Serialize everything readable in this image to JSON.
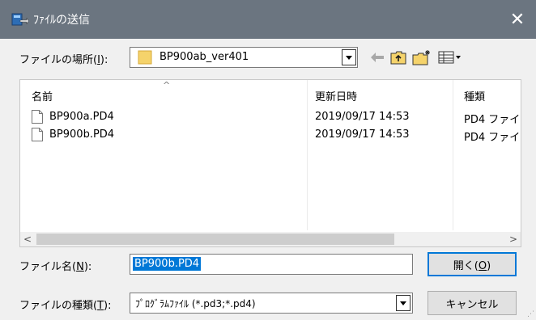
{
  "window": {
    "title": "ﾌｧｲﾙの送信",
    "close_glyph": "✕"
  },
  "lookin": {
    "label": "ファイルの場所(",
    "label_key": "I",
    "label_end": "):",
    "value": "BP900ab_ver401"
  },
  "toolbar": {
    "back_icon": "back-arrow-icon",
    "up_icon": "up-folder-icon",
    "new_folder_icon": "new-folder-icon",
    "view_menu_icon": "view-menu-icon"
  },
  "list": {
    "columns": [
      {
        "label": "名前"
      },
      {
        "label": "更新日時"
      },
      {
        "label": "種類"
      }
    ],
    "rows": [
      {
        "name": "BP900a.PD4",
        "date": "2019/09/17 14:53",
        "type": "PD4 ファイ|"
      },
      {
        "name": "BP900b.PD4",
        "date": "2019/09/17 14:53",
        "type": "PD4 ファイ|"
      }
    ],
    "scroll_left": "<",
    "scroll_right": ">"
  },
  "filename": {
    "label": "ファイル名(",
    "label_key": "N",
    "label_end": "):",
    "value": "BP900b.PD4"
  },
  "filetype": {
    "label": "ファイルの種類(",
    "label_key": "T",
    "label_end": "):",
    "value": "ﾌﾟﾛｸﾞﾗﾑﾌｧｲﾙ (*.pd3;*.pd4)"
  },
  "buttons": {
    "open_label": "開く(",
    "open_key": "O",
    "open_end": ")",
    "cancel_label": "キャンセル"
  },
  "colors": {
    "titlebar": "#6b7580",
    "selection": "#0078d7",
    "dialog_bg": "#f0f0f0"
  }
}
